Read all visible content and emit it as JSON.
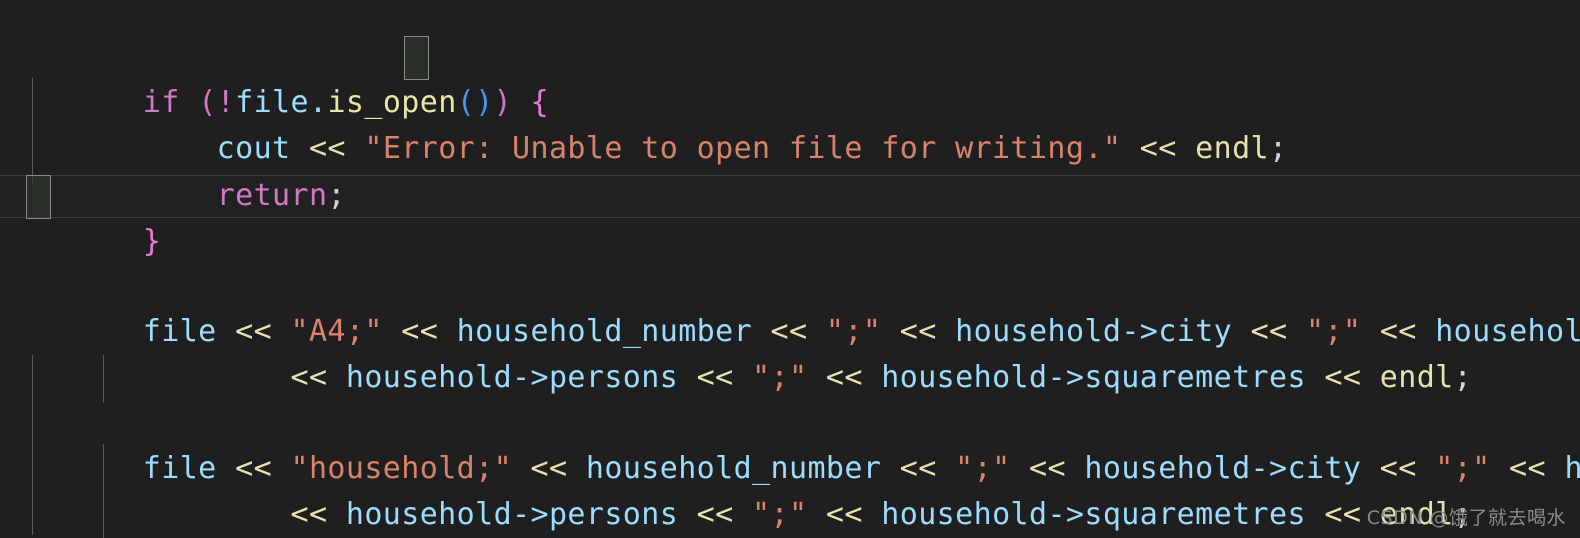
{
  "editor": {
    "background_color": "#1f1f1f",
    "current_line_color": "#212121",
    "language": "C++"
  },
  "theme": {
    "keyword": "#d179c6",
    "identifier": "#9cdcfe",
    "string": "#d9836b",
    "operator": "#e4e4ae",
    "function": "#e6e6a8",
    "paren": "#3d9bf0",
    "brace": "#e879d8",
    "indent_guide": "#5a5a5a",
    "bracket_match_border": "#8a8a8a"
  },
  "code": {
    "line1": {
      "kw_if": "if",
      "sp1": " ",
      "paren_open": "(",
      "bang": "!",
      "obj": "file",
      "dot": ".",
      "method": "is_open",
      "call_parens": "()",
      "paren_close": ")",
      "sp2": " ",
      "brace_open": "{"
    },
    "line2": {
      "indent": "    ",
      "stream": "cout",
      "op1": " << ",
      "string": "\"Error: Unable to open file for writing.\"",
      "op2": " << ",
      "endl": "endl",
      "semi": ";"
    },
    "line3": {
      "indent": "    ",
      "kw_return": "return",
      "semi": ";"
    },
    "line4": {
      "brace_close": "}"
    },
    "line6": {
      "stream": "file",
      "op1": " << ",
      "string1": "\"A4;\"",
      "op2": " << ",
      "ident1": "household_number",
      "op3": " << ",
      "string2": "\";\"",
      "op4": " << ",
      "ident2": "household->city",
      "op5": " << ",
      "string3": "\";\"",
      "op6": " << ",
      "ident3": "household->water"
    },
    "line7": {
      "indent": "        ",
      "op1": "<< ",
      "ident1": "household->persons",
      "op2": " << ",
      "string1": "\";\"",
      "op3": " << ",
      "ident2": "household->squaremetres",
      "op4": " << ",
      "endl": "endl",
      "semi": ";"
    },
    "line9": {
      "stream": "file",
      "op1": " << ",
      "string1": "\"household;\"",
      "op2": " << ",
      "ident1": "household_number",
      "op3": " << ",
      "string2": "\";\"",
      "op4": " << ",
      "ident2": "household->city",
      "op5": " << ",
      "string3": "\";\"",
      "op6": " << ",
      "ident3": "household"
    },
    "line10": {
      "indent": "        ",
      "op1": "<< ",
      "ident1": "household->persons",
      "op2": " << ",
      "string1": "\";\"",
      "op3": " << ",
      "ident2": "household->squaremetres",
      "op4": " << ",
      "endl": "endl",
      "semi": ";"
    }
  },
  "watermark": {
    "text": "CSDN @饿了就去喝水"
  }
}
